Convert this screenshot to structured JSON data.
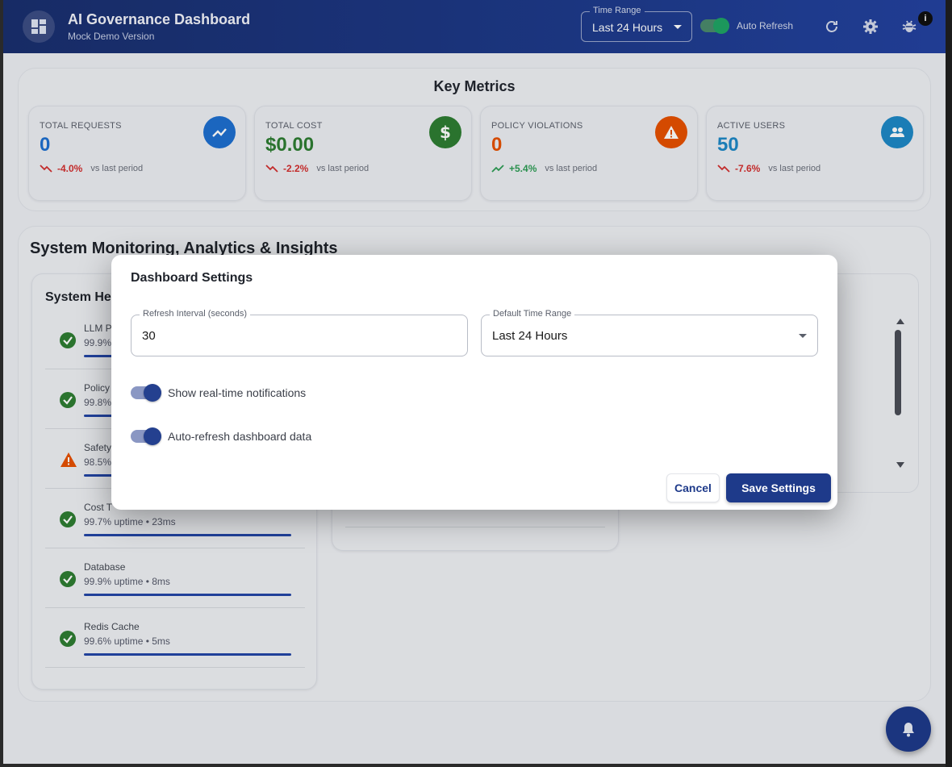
{
  "header": {
    "title": "AI Governance Dashboard",
    "subtitle": "Mock Demo Version",
    "time_range_label": "Time Range",
    "time_range_value": "Last 24 Hours",
    "auto_refresh_label": "Auto Refresh",
    "auto_refresh_on": true,
    "notification_badge": "i",
    "icons": [
      "dashboard-icon",
      "refresh-icon",
      "gear-icon",
      "bug-icon"
    ]
  },
  "metrics": {
    "title": "Key Metrics",
    "cards": [
      {
        "label": "TOTAL REQUESTS",
        "value": "0",
        "trend": "-4.0%",
        "trend_dir": "down",
        "note": "vs last period",
        "color": "#1e6fd0",
        "icon": "trending-up-icon"
      },
      {
        "label": "TOTAL COST",
        "value": "$0.00",
        "trend": "-2.2%",
        "trend_dir": "down",
        "note": "vs last period",
        "color": "#2e7d32",
        "icon": "dollar-icon"
      },
      {
        "label": "POLICY VIOLATIONS",
        "value": "0",
        "trend": "+5.4%",
        "trend_dir": "up",
        "note": "vs last period",
        "color": "#e65100",
        "icon": "warning-icon"
      },
      {
        "label": "ACTIVE USERS",
        "value": "50",
        "trend": "-7.6%",
        "trend_dir": "down",
        "note": "vs last period",
        "color": "#1e88c6",
        "icon": "people-icon"
      }
    ]
  },
  "monitoring": {
    "title": "System Monitoring, Analytics & Insights",
    "health_title": "System Hea",
    "services": [
      {
        "name": "LLM P",
        "detail": "99.9%",
        "status": "ok"
      },
      {
        "name": "Policy",
        "detail": "99.8%",
        "status": "ok"
      },
      {
        "name": "Safety",
        "detail": "98.5%",
        "status": "warning"
      },
      {
        "name": "Cost T",
        "detail": "99.7% uptime • 23ms",
        "status": "ok"
      },
      {
        "name": "Database",
        "detail": "99.9% uptime • 8ms",
        "status": "ok"
      },
      {
        "name": "Redis Cache",
        "detail": "99.6% uptime • 5ms",
        "status": "ok"
      }
    ]
  },
  "modal": {
    "title": "Dashboard Settings",
    "refresh_label": "Refresh Interval (seconds)",
    "refresh_value": "30",
    "range_label": "Default Time Range",
    "range_value": "Last 24 Hours",
    "toggle_notifications": "Show real-time notifications",
    "toggle_autorefresh": "Auto-refresh dashboard data",
    "notifications_on": true,
    "autorefresh_on": true,
    "cancel": "Cancel",
    "save": "Save Settings"
  },
  "colors": {
    "primary": "#1e3a8a",
    "success": "#2e7d32",
    "warning": "#e65100",
    "danger": "#d32f2f",
    "positive_trend": "#2e9d55"
  }
}
